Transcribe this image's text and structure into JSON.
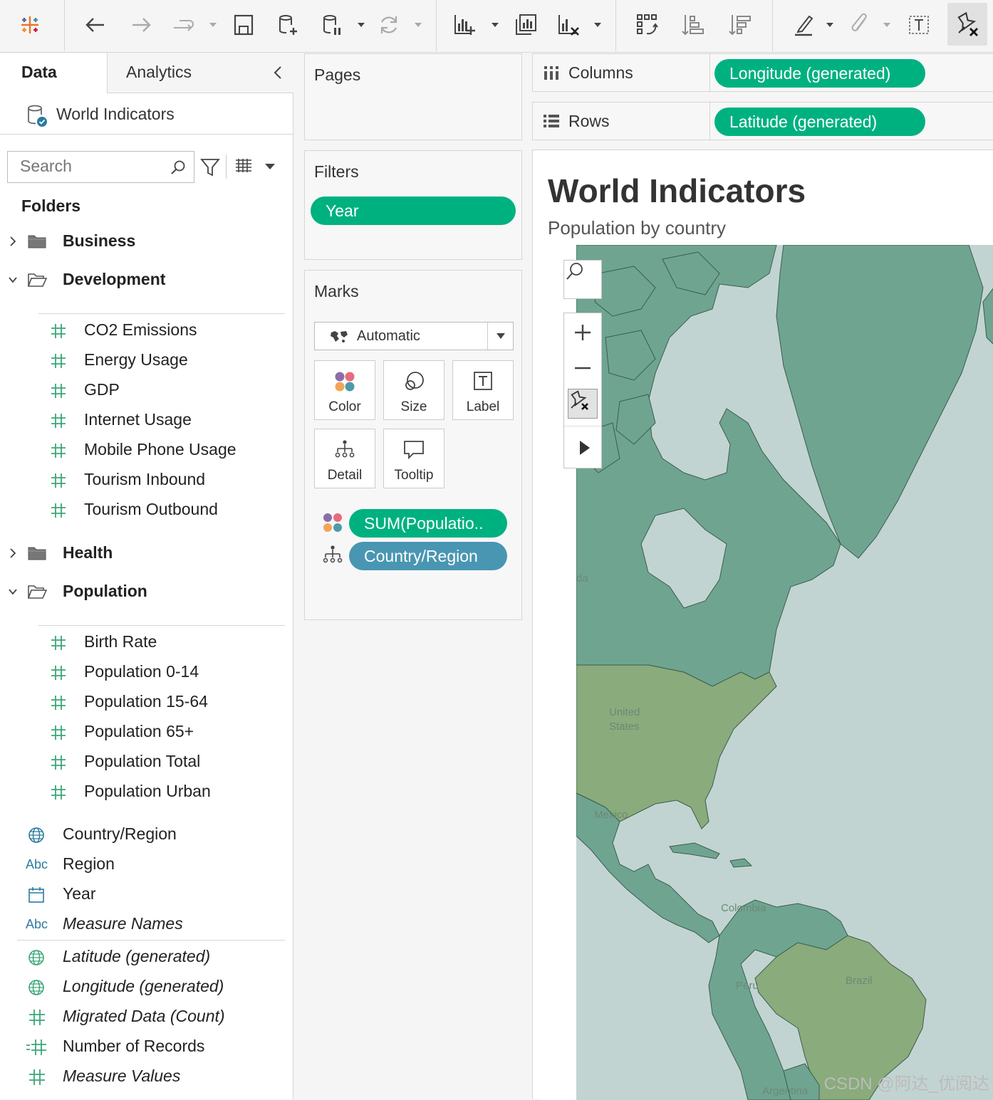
{
  "left_panel": {
    "tabs": {
      "data": "Data",
      "analytics": "Analytics"
    },
    "datasource": "World Indicators",
    "search_placeholder": "Search",
    "folders_title": "Folders",
    "folders": [
      {
        "name": "Business",
        "expanded": false
      },
      {
        "name": "Development",
        "expanded": true,
        "fields": [
          "CO2 Emissions",
          "Energy Usage",
          "GDP",
          "Internet Usage",
          "Mobile Phone Usage",
          "Tourism Inbound",
          "Tourism Outbound"
        ]
      },
      {
        "name": "Health",
        "expanded": false
      },
      {
        "name": "Population",
        "expanded": true,
        "fields": [
          "Birth Rate",
          "Population 0-14",
          "Population 15-64",
          "Population 65+",
          "Population Total",
          "Population Urban"
        ]
      }
    ],
    "dimensions": [
      {
        "name": "Country/Region",
        "icon": "globe-icon"
      },
      {
        "name": "Region",
        "icon": "Abc"
      },
      {
        "name": "Year",
        "icon": "calendar-icon"
      },
      {
        "name": "Measure Names",
        "icon": "Abc"
      }
    ],
    "generated": [
      {
        "name": "Latitude (generated)",
        "icon": "globe-icon"
      },
      {
        "name": "Longitude (generated)",
        "icon": "globe-icon"
      },
      {
        "name": "Migrated Data (Count)",
        "icon": "hash-icon"
      },
      {
        "name": "Number of Records",
        "icon": "hash-icon"
      },
      {
        "name": "Measure Values",
        "icon": "hash-icon"
      }
    ]
  },
  "cards": {
    "pages": "Pages",
    "filters": {
      "title": "Filters",
      "pill": "Year"
    },
    "marks": {
      "title": "Marks",
      "type": "Automatic",
      "buttons": [
        "Color",
        "Size",
        "Label",
        "Detail",
        "Tooltip"
      ],
      "fields": [
        "SUM(Populatio..",
        "Country/Region"
      ]
    }
  },
  "shelves": {
    "columns": {
      "label": "Columns",
      "pill": "Longitude (generated)"
    },
    "rows": {
      "label": "Rows",
      "pill": "Latitude (generated)"
    }
  },
  "view": {
    "title": "World Indicators",
    "subtitle": "Population by country",
    "map_labels": [
      "United",
      "States",
      "Mexico",
      "Colombia",
      "Peru",
      "Brazil",
      "Argentina",
      "da"
    ],
    "watermark": "CSDN @阿达_优阅达"
  },
  "colors": {
    "accent_green": "#00b180",
    "dimension_blue": "#4996b2",
    "land": "#6fa590",
    "land_high": "#8aab7c",
    "water": "#c2d4d2"
  }
}
